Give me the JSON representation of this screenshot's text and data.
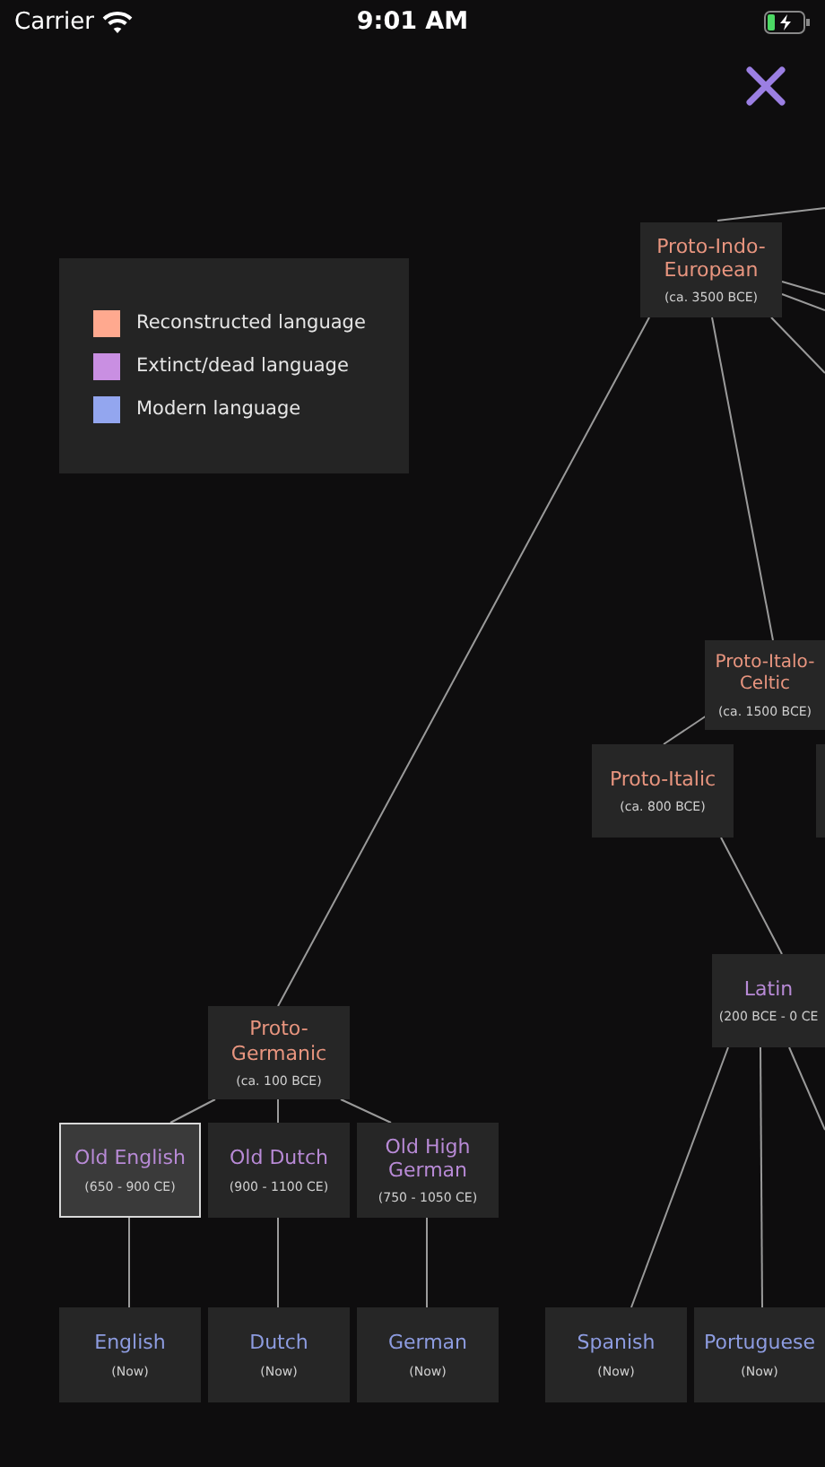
{
  "status_bar": {
    "carrier": "Carrier",
    "time": "9:01 AM"
  },
  "legend": [
    {
      "label": "Reconstructed language",
      "color": "#ffa98f"
    },
    {
      "label": "Extinct/dead language",
      "color": "#c98fe2"
    },
    {
      "label": "Modern language",
      "color": "#93a6ef"
    }
  ],
  "nodes": [
    {
      "name": "Proto-Indo-European",
      "date": "(ca. 3500 BCE)",
      "kind": "reconstructed",
      "selected": false
    },
    {
      "name": "Proto-Italo-Celtic",
      "date": "(ca. 1500 BCE)",
      "kind": "reconstructed",
      "selected": false
    },
    {
      "name": "Proto-Italic",
      "date": "(ca. 800 BCE)",
      "kind": "reconstructed",
      "selected": false
    },
    {
      "name": "Latin",
      "date": "(200 BCE - 0 CE",
      "kind": "extinct",
      "selected": false
    },
    {
      "name": "Proto-Germanic",
      "date": "(ca. 100 BCE)",
      "kind": "reconstructed",
      "selected": false
    },
    {
      "name": "Old English",
      "date": "(650 - 900 CE)",
      "kind": "extinct",
      "selected": true
    },
    {
      "name": "Old Dutch",
      "date": "(900 - 1100 CE)",
      "kind": "extinct",
      "selected": false
    },
    {
      "name": "Old High German",
      "date": "(750 - 1050 CE)",
      "kind": "extinct",
      "selected": false
    },
    {
      "name": "English",
      "date": "(Now)",
      "kind": "modern",
      "selected": false
    },
    {
      "name": "Dutch",
      "date": "(Now)",
      "kind": "modern",
      "selected": false
    },
    {
      "name": "German",
      "date": "(Now)",
      "kind": "modern",
      "selected": false
    },
    {
      "name": "Spanish",
      "date": "(Now)",
      "kind": "modern",
      "selected": false
    },
    {
      "name": "Portuguese",
      "date": "(Now)",
      "kind": "modern",
      "selected": false
    }
  ]
}
